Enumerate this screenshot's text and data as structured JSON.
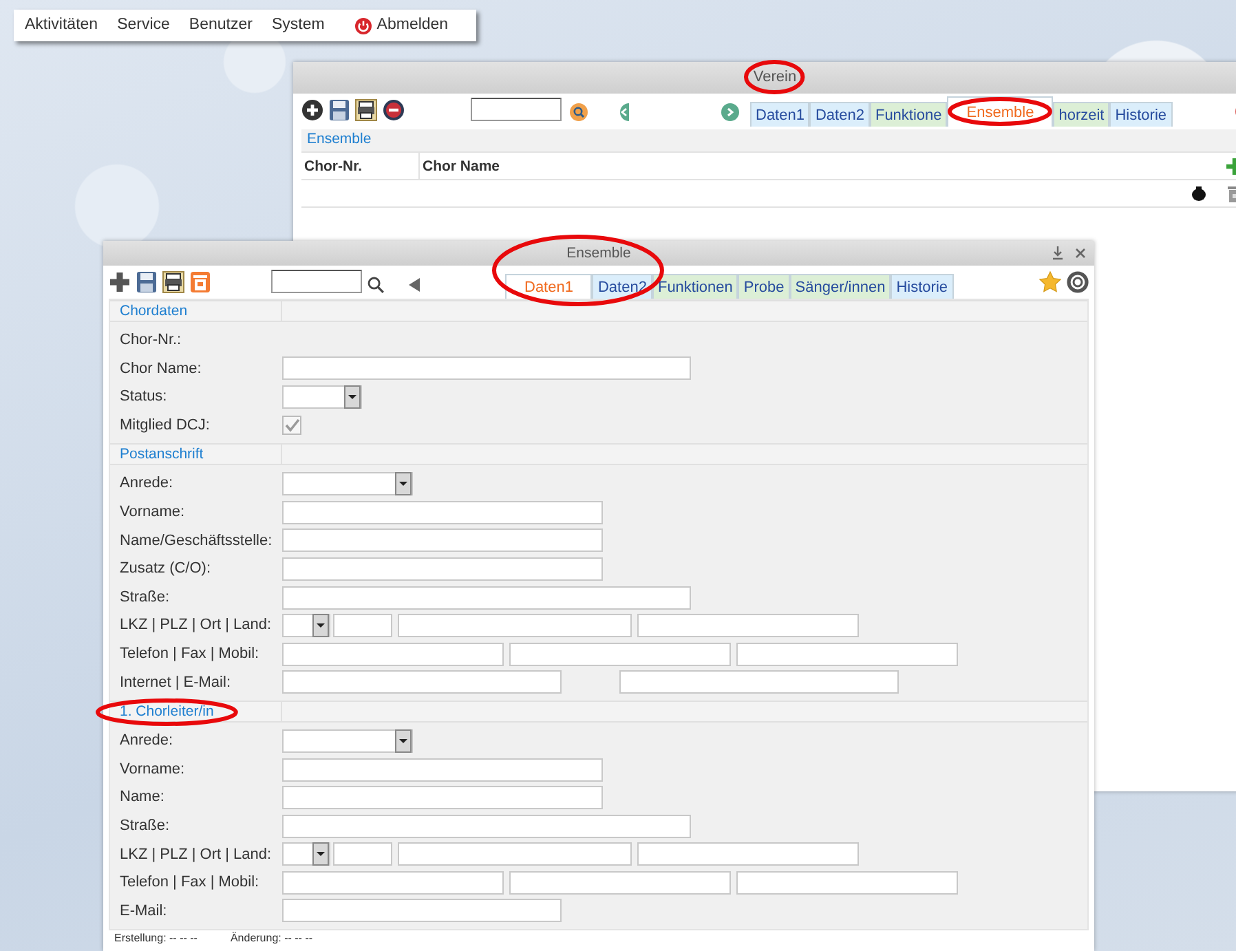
{
  "menu": [
    {
      "label": "Aktivitäten",
      "kind": "text"
    },
    {
      "label": "Service",
      "kind": "text"
    },
    {
      "label": "Benutzer",
      "kind": "text"
    },
    {
      "label": "System",
      "kind": "text"
    },
    {
      "label": "Abmelden",
      "kind": "logout"
    }
  ],
  "verein_window": {
    "title": "Verein",
    "tabs": [
      {
        "label": "Daten1",
        "selected": false
      },
      {
        "label": "Daten2",
        "selected": false
      },
      {
        "label": "Funktione",
        "selected": false
      },
      {
        "label": "Ensemble",
        "selected": true
      },
      {
        "label": "horzeit",
        "selected": false
      },
      {
        "label": "Historie",
        "selected": false
      }
    ],
    "section_title": "Ensemble",
    "columns": [
      "Chor-Nr.",
      "Chor Name"
    ]
  },
  "ensemble_window": {
    "title": "Ensemble",
    "tabs": [
      {
        "label": "Daten1",
        "selected": true
      },
      {
        "label": "Daten2",
        "selected": false
      },
      {
        "label": "Funktionen",
        "selected": false
      },
      {
        "label": "Probe",
        "selected": false
      },
      {
        "label": "Sänger/innen",
        "selected": false
      },
      {
        "label": "Historie",
        "selected": false
      }
    ],
    "sections": [
      {
        "title": "Chordaten",
        "fields": [
          {
            "label": "Chor-Nr.:",
            "kind": "plain"
          },
          {
            "label": "Chor Name:",
            "kind": "wide"
          },
          {
            "label": "Status:",
            "kind": "status"
          },
          {
            "label": "Mitglied DCJ:",
            "kind": "checkbox",
            "checked": true,
            "disabled": true
          }
        ]
      },
      {
        "title": "Postanschrift",
        "fields": [
          {
            "label": "Anrede:",
            "kind": "salutation"
          },
          {
            "label": "Vorname:",
            "kind": "medium"
          },
          {
            "label": "Name/Geschäftsstelle:",
            "kind": "medium"
          },
          {
            "label": "Zusatz (C/O):",
            "kind": "medium"
          },
          {
            "label": "Straße:",
            "kind": "wide"
          },
          {
            "label": "LKZ | PLZ | Ort | Land:",
            "kind": "address"
          },
          {
            "label": "Telefon | Fax | Mobil:",
            "kind": "phone"
          },
          {
            "label": "Internet | E-Mail:",
            "kind": "web"
          }
        ]
      },
      {
        "title": "1. Chorleiter/in",
        "fields": [
          {
            "label": "Anrede:",
            "kind": "salutation"
          },
          {
            "label": "Vorname:",
            "kind": "medium"
          },
          {
            "label": "Name:",
            "kind": "medium"
          },
          {
            "label": "Straße:",
            "kind": "wide"
          },
          {
            "label": "LKZ | PLZ | Ort | Land:",
            "kind": "address"
          },
          {
            "label": "Telefon | Fax | Mobil:",
            "kind": "phone"
          },
          {
            "label": "E-Mail:",
            "kind": "short"
          }
        ]
      }
    ],
    "footer": [
      "Erstellung: -- -- --",
      "Änderung: -- -- --"
    ]
  }
}
